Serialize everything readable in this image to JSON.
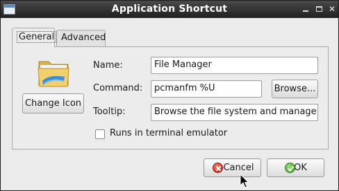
{
  "window": {
    "title": "Application Shortcut"
  },
  "tabs": [
    {
      "label": "General"
    },
    {
      "label": "Advanced"
    }
  ],
  "general": {
    "icon": "file-manager-folder-icon",
    "change_icon_label": "Change Icon",
    "name_label": "Name:",
    "name_value": "File Manager",
    "command_label": "Command:",
    "command_value": "pcmanfm %U",
    "browse_label": "Browse...",
    "tooltip_label": "Tooltip:",
    "tooltip_value": "Browse the file system and manage t",
    "terminal_label": "Runs in terminal emulator",
    "terminal_checked": false
  },
  "buttons": {
    "cancel_label": "Cancel",
    "ok_label": "OK"
  },
  "colors": {
    "titlebar": "#2e2e2e",
    "window_bg": "#ebebeb",
    "cancel_icon": "#c01e10",
    "ok_icon": "#3c9a1e"
  }
}
